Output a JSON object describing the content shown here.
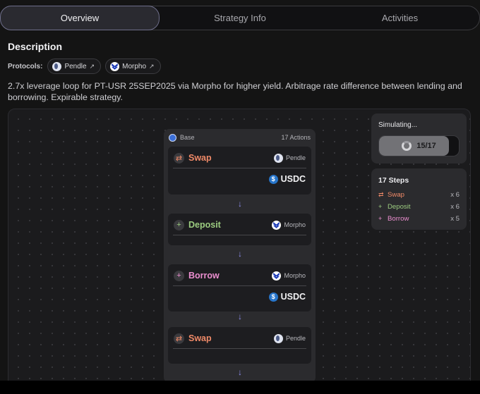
{
  "tabs": [
    {
      "label": "Overview",
      "active": true
    },
    {
      "label": "Strategy Info",
      "active": false
    },
    {
      "label": "Activities",
      "active": false
    }
  ],
  "description": {
    "heading": "Description",
    "protocols_label": "Protocols:",
    "protocols": [
      {
        "name": "Pendle",
        "link_icon": "external-link-icon"
      },
      {
        "name": "Morpho",
        "link_icon": "external-link-icon"
      }
    ],
    "text": "2.7x leverage loop for PT-USR 25SEP2025  via Morpho for higher yield. Arbitrage rate difference between lending and borrowing. Expirable strategy."
  },
  "flow": {
    "base_label": "Base",
    "actions_count": "17 Actions",
    "steps": [
      {
        "op": "Swap",
        "icon": "swap-icon",
        "protocol": "Pendle",
        "token": "USDC"
      },
      {
        "op": "Deposit",
        "icon": "plus-icon",
        "protocol": "Morpho",
        "token": ""
      },
      {
        "op": "Borrow",
        "icon": "plus-icon",
        "protocol": "Morpho",
        "token": "USDC"
      },
      {
        "op": "Swap",
        "icon": "swap-icon",
        "protocol": "Pendle",
        "token": ""
      }
    ]
  },
  "simulation": {
    "title": "Simulating...",
    "progress_text": "15/17",
    "progress_fraction": 0.88
  },
  "summary": {
    "title": "17 Steps",
    "items": [
      {
        "label": "Swap",
        "count": "x 6"
      },
      {
        "label": "Deposit",
        "count": "x 6"
      },
      {
        "label": "Borrow",
        "count": "x 5"
      }
    ]
  },
  "colors": {
    "swap": "#f08a68",
    "deposit": "#9ccc80",
    "borrow": "#ec8fd0",
    "arrow": "#8f8ff2",
    "usdc": "#2775ca"
  }
}
